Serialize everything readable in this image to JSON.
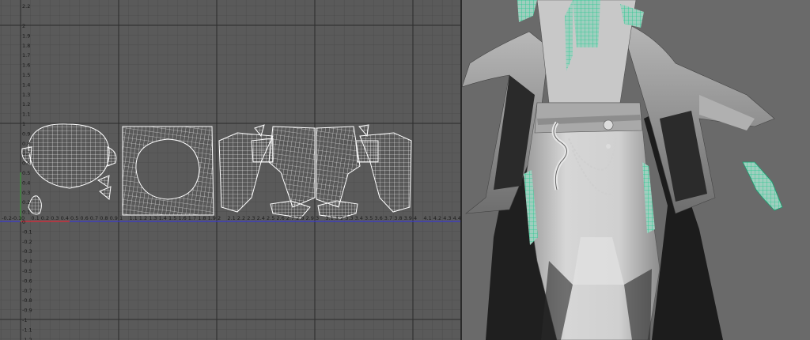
{
  "app": {
    "panels": [
      "UV Editor",
      "Perspective Viewport"
    ]
  },
  "uv_editor": {
    "v_labels_top": [
      "2.2",
      "2",
      "1.9",
      "1.8",
      "1.7",
      "1.6",
      "1.5",
      "1.4",
      "1.3",
      "1.2",
      "1.1",
      "1",
      "0.9",
      "0.8",
      "0.7",
      "0.6",
      "0.5",
      "0.4",
      "0.3",
      "0.2",
      "0.1",
      "0"
    ],
    "v_labels_bottom": [
      "-0.1",
      "-0.2",
      "-0.3",
      "-0.4",
      "-0.5",
      "-0.6",
      "-0.7",
      "-0.8",
      "-0.9",
      "-1",
      "-1.1",
      "-1.2"
    ],
    "u_labels": [
      "-0.3",
      "-0.2",
      "-0.1",
      "0",
      "0.1",
      "0.2",
      "0.3",
      "0.4",
      "0.5",
      "0.6",
      "0.7",
      "0.8",
      "0.9",
      "1",
      "1.1",
      "1.2",
      "1.3",
      "1.4",
      "1.5",
      "1.6",
      "1.7",
      "1.8",
      "1.9",
      "2",
      "2.1",
      "2.2",
      "2.3",
      "2.4",
      "2.5",
      "2.6",
      "2.7",
      "2.8",
      "2.9",
      "3",
      "3.1",
      "3.2",
      "3.3",
      "3.4",
      "3.5",
      "3.6",
      "3.7",
      "3.8",
      "3.9",
      "4",
      "4.1",
      "4.2",
      "4.3",
      "4.4"
    ],
    "uv_shells": [
      "head-shell",
      "face-circle-shell",
      "torso-left-shell",
      "arm-left-shell",
      "arm-right-shell",
      "torso-right-shell",
      "eye-shell",
      "hand-left-shell",
      "hand-right-shell",
      "ear-left-shell",
      "ear-right-shell"
    ],
    "colors": {
      "background": "#5a5a5a",
      "grid_major": "#2b2b2b",
      "grid_minor": "#4e4e4e",
      "axis_u": "#3b3bcc",
      "origin_v": "#3a8a3a",
      "origin_u": "#cc3333",
      "wire": "#ffffff"
    }
  },
  "viewport": {
    "subject": "robed-character-model",
    "colors": {
      "background": "#6a6a6a",
      "mesh": "#c9c9c9",
      "shadow": "#1c1c1c",
      "selection_wire": "#37d6a0"
    }
  }
}
